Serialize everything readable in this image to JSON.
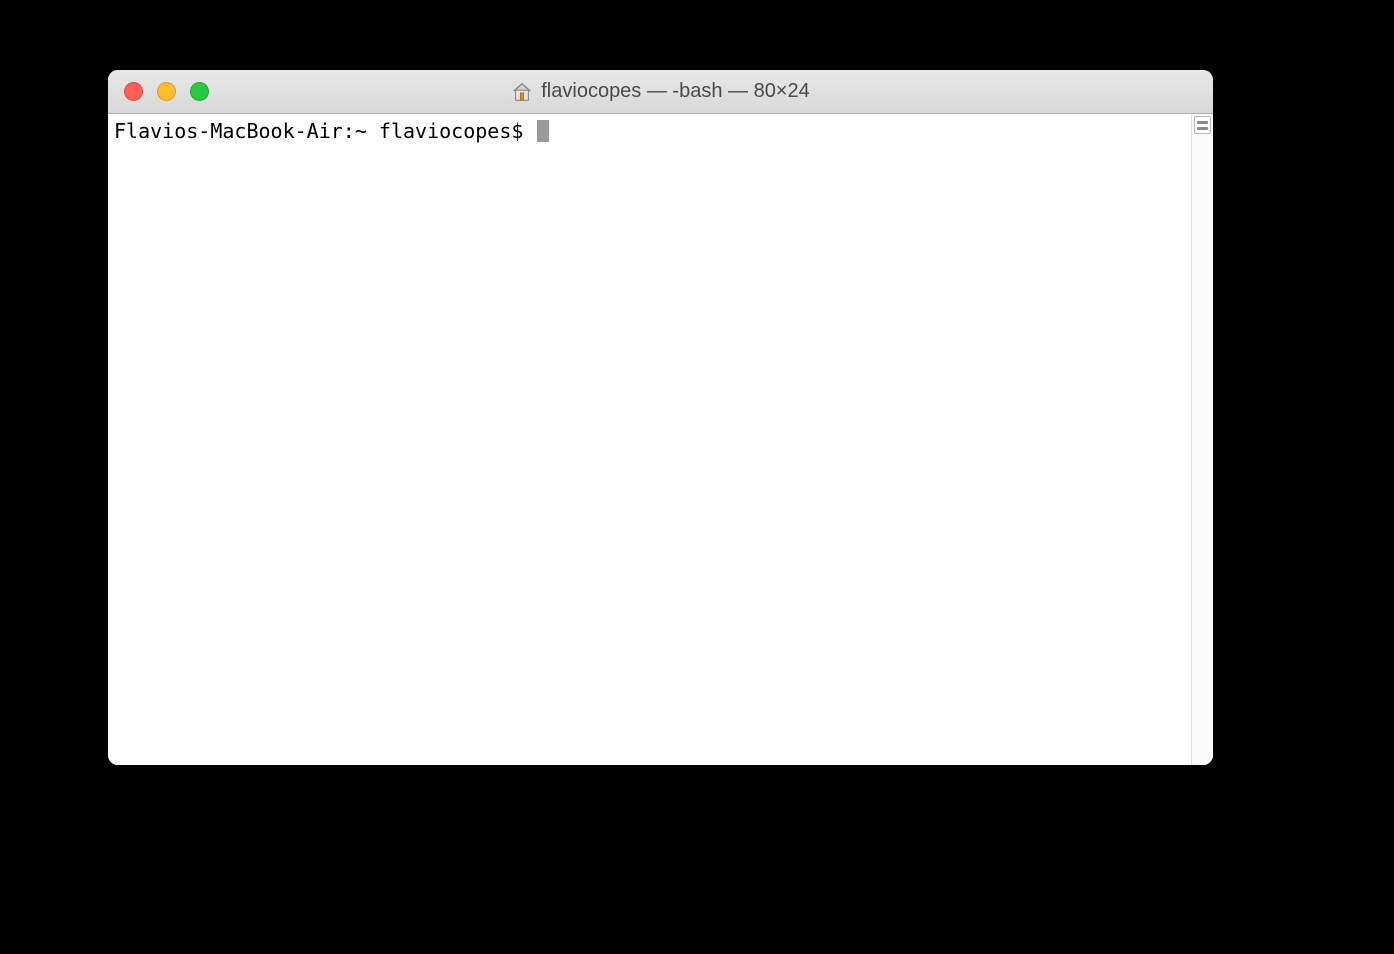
{
  "window": {
    "title": "flaviocopes — -bash — 80×24"
  },
  "terminal": {
    "prompt": "Flavios-MacBook-Air:~ flaviocopes$ "
  }
}
